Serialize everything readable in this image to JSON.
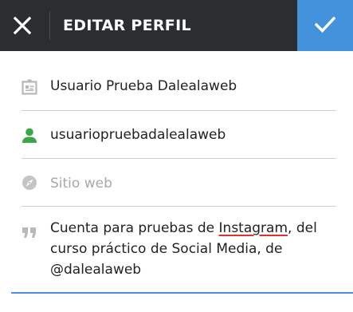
{
  "header": {
    "title": "EDITAR PERFIL",
    "close_icon": "close-icon",
    "confirm_icon": "checkmark-icon",
    "confirm_color": "#4592dc",
    "bar_color": "#2b2d30"
  },
  "fields": {
    "name": {
      "icon": "id-card-icon",
      "value": "Usuario Prueba Dalealaweb"
    },
    "username": {
      "icon": "person-icon",
      "icon_color": "#3aa54a",
      "value": "usuariopruebadalealaweb"
    },
    "website": {
      "icon": "compass-icon",
      "placeholder": "Sitio web"
    },
    "bio": {
      "icon": "quote-icon",
      "line1_before": "Cuenta para pruebas de ",
      "line1_misspelled": "Instagram",
      "line1_after": ", del",
      "line2": "curso práctico de Social Media, de",
      "line3": "@dalealaweb",
      "focus_color": "#4f8fdb"
    }
  }
}
